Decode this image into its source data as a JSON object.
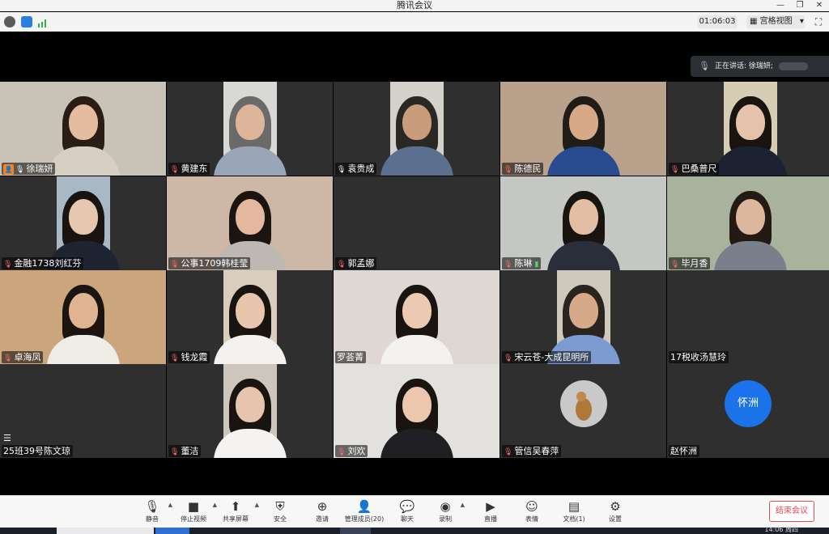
{
  "window": {
    "title": "腾讯会议",
    "min": "—",
    "restore": "❐",
    "close": "✕"
  },
  "infobar": {
    "timer": "01:06:03",
    "view_label": "宫格视图",
    "view_caret": "▾",
    "fullscreen": "⛶"
  },
  "speaking": {
    "label": "正在讲话: 徐瑞妍;"
  },
  "participants": [
    {
      "name": "徐瑞妍",
      "mic": "on",
      "host": true,
      "bg": "#c9c2b6",
      "hair": "#2a1d16",
      "body": "#d8cfc4",
      "skin": "#e4bca0"
    },
    {
      "name": "黄建东",
      "mic": "muted",
      "bg": "#d8d9d4",
      "hair": "#6a6a6a",
      "body": "#9aa6b8",
      "skin": "#dcb59a"
    },
    {
      "name": "袁贵成",
      "mic": "on",
      "bg": "#d3d1c9",
      "hair": "#2b2724",
      "body": "#5b6f8e",
      "skin": "#c99d7c"
    },
    {
      "name": "陈德民",
      "mic": "muted",
      "bg": "#b9a18c",
      "hair": "#201c18",
      "body": "#284a8f",
      "skin": "#d8a987"
    },
    {
      "name": "巴桑普尺",
      "mic": "muted",
      "bg": "#d7cdb5",
      "hair": "#1a1410",
      "body": "#1d2233",
      "skin": "#e6c2aa"
    },
    {
      "name": "金融1738刘红芬",
      "mic": "muted",
      "bg": "#a9b8c5",
      "hair": "#1a1410",
      "body": "#1e2432",
      "skin": "#e8c7b1"
    },
    {
      "name": "公事1709韩桂莹",
      "mic": "muted",
      "bg": "#cdb7a6",
      "hair": "#1c1410",
      "body": "#bdb8b2",
      "skin": "#e3b89e"
    },
    {
      "name": "郭孟娜",
      "mic": "muted",
      "empty": true
    },
    {
      "name": "陈琳",
      "mic": "muted",
      "signal": true,
      "bg": "#c5c7c2",
      "hair": "#1a1410",
      "body": "#2a2e3a",
      "skin": "#e3bea4"
    },
    {
      "name": "毕月香",
      "mic": "muted",
      "bg": "#a9b29c",
      "hair": "#241a14",
      "body": "#7a7f8c",
      "skin": "#dcb79e"
    },
    {
      "name": "卓海凤",
      "mic": "muted",
      "bg": "#cba57c",
      "hair": "#1c1410",
      "body": "#f0ece6",
      "skin": "#e0b392"
    },
    {
      "name": "钱龙霞",
      "mic": "muted",
      "bg": "#d9cdbd",
      "hair": "#1a1410",
      "body": "#f3f2ef",
      "skin": "#e8c6ad"
    },
    {
      "name": "罗荟菁",
      "mic": "none",
      "bg": "#ded7d3",
      "hair": "#1a1410",
      "body": "#f4f2f0",
      "skin": "#ecc9b3"
    },
    {
      "name": "宋云苍-大成昆明所",
      "mic": "muted",
      "bg": "#cfc8bd",
      "hair": "#2a2420",
      "body": "#7d9bd1",
      "skin": "#d6a988"
    },
    {
      "name": "17税收汤慧玲",
      "mic": "none",
      "empty": true
    },
    {
      "name": "25班39号陈文琼",
      "mic": "none",
      "empty": true,
      "list_icon": "☰"
    },
    {
      "name": "董洁",
      "mic": "muted",
      "bg": "#cdc6bd",
      "hair": "#1a1410",
      "body": "#f4f3f1",
      "skin": "#e7c4ad"
    },
    {
      "name": "刘欢",
      "mic": "muted",
      "bg": "#e3e1dd",
      "hair": "#1a1410",
      "body": "#1f1f24",
      "skin": "#ecc7ae"
    },
    {
      "name": "管信吴春萍",
      "mic": "muted",
      "avatar": "dog"
    },
    {
      "name": "赵怀洲",
      "mic": "none",
      "avatar_text": "怀洲"
    }
  ],
  "toolbar": {
    "mute": {
      "label": "静音",
      "icon": "🎙"
    },
    "video": {
      "label": "停止视频",
      "icon": "■"
    },
    "share": {
      "label": "共享屏幕",
      "icon": "⬆"
    },
    "security": {
      "label": "安全",
      "icon": "⛨"
    },
    "invite": {
      "label": "邀请",
      "icon": "⊕"
    },
    "members": {
      "label": "管理成员(20)",
      "icon": "👤"
    },
    "chat": {
      "label": "聊天",
      "icon": "💬"
    },
    "record": {
      "label": "录制",
      "icon": "◉"
    },
    "live": {
      "label": "直播",
      "icon": "▶"
    },
    "emoji": {
      "label": "表情",
      "icon": "☺"
    },
    "docs": {
      "label": "文档(1)",
      "icon": "▤"
    },
    "settings": {
      "label": "设置",
      "icon": "⚙"
    },
    "caret": "▲",
    "end": "结束会议"
  },
  "taskbar": {
    "clock": "14:06 周四"
  },
  "colors": {
    "end_red": "#e14b4b",
    "avatar_blue": "#1a73e8",
    "host_orange": "#f5821f"
  }
}
